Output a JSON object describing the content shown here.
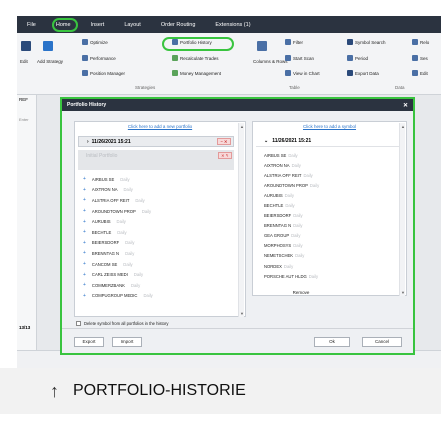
{
  "menubar": {
    "items": [
      "File",
      "Home",
      "Insert",
      "Layout",
      "Order Routing",
      "Extensions (1)"
    ]
  },
  "ribbon": {
    "edit": "Edit",
    "add_strategy": "Add Strategy",
    "optimize": "Optimize",
    "portfolio_history": "Portfolio History",
    "performance": "Performance",
    "recalculate_trades": "Recalculate Trades",
    "position_manager": "Position Manager",
    "money_management": "Money Management",
    "strategies_label": "Strategies",
    "columns_rows": "Columns & Rows",
    "filter": "Filter",
    "start_scan": "Start Scan",
    "view_in_chart": "View in Chart",
    "table_label": "Table",
    "symbol_search": "Symbol Search",
    "reload": "Relo",
    "period": "Period",
    "sess": "Ses",
    "export_data": "Export Data",
    "edit2": "Edit",
    "data_label": "Data"
  },
  "app": {
    "ref_label": "REF",
    "enter_label": "Enter",
    "date_small": "13/13"
  },
  "dialog": {
    "title": "Portfolio History",
    "left_add_link": "Click here to add a new portfolio",
    "right_add_link": "Click here to add a symbol",
    "left_header_date": "11/26/2021 15:21",
    "right_header_date": "11/26/2021 15:21",
    "initial_portfolio": "Initial Portfolio",
    "left_items": [
      {
        "name": "AIRBUS SE",
        "tag": "Daily"
      },
      {
        "name": "AIXTRON NA",
        "tag": "Daily"
      },
      {
        "name": "ALSTRIA OFF REIT",
        "tag": "Daily"
      },
      {
        "name": "AROUNDTOWN PROP",
        "tag": "Daily"
      },
      {
        "name": "AURUBIS",
        "tag": "Daily"
      },
      {
        "name": "BECHTLE",
        "tag": "Daily"
      },
      {
        "name": "BEIERSDORF",
        "tag": "Daily"
      },
      {
        "name": "BRENNTAG N",
        "tag": "Daily"
      },
      {
        "name": "CANCOM SE",
        "tag": "Daily"
      },
      {
        "name": "CARL ZEISS MEDI",
        "tag": "Daily"
      },
      {
        "name": "COMMERZBANK",
        "tag": "Daily"
      },
      {
        "name": "COMPUGROUP MEDIC",
        "tag": "Daily"
      }
    ],
    "right_items": [
      {
        "name": "AIRBUS SE",
        "tag": "Daily"
      },
      {
        "name": "AIXTRON NA",
        "tag": "Daily"
      },
      {
        "name": "ALSTRIA OFF REIT",
        "tag": "Daily"
      },
      {
        "name": "AROUNDTOWN PROP",
        "tag": "Daily"
      },
      {
        "name": "AURUBIS",
        "tag": "Daily"
      },
      {
        "name": "BECHTLE",
        "tag": "Daily"
      },
      {
        "name": "BEIERSDORF",
        "tag": "Daily"
      },
      {
        "name": "BRENNTAG N",
        "tag": "Daily"
      },
      {
        "name": "GEA GROUP",
        "tag": "Daily"
      },
      {
        "name": "MORPHOSYS",
        "tag": "Daily"
      },
      {
        "name": "NEMETSCHEK",
        "tag": "Daily"
      },
      {
        "name": "NORDEX",
        "tag": "Daily"
      },
      {
        "name": "PORSCHE AUT HLDG",
        "tag": "Daily"
      }
    ],
    "remove": "Remove",
    "delete_checkbox": "Delete symbol from all portfolios in the history",
    "export": "Export",
    "import": "Import",
    "ok": "Ok",
    "cancel": "Cancel"
  },
  "caption": {
    "text": "PORTFOLIO-HISTORIE"
  },
  "colors": {
    "highlight": "#39c43f",
    "titlebar": "#2b3340",
    "link": "#2a73c9"
  }
}
